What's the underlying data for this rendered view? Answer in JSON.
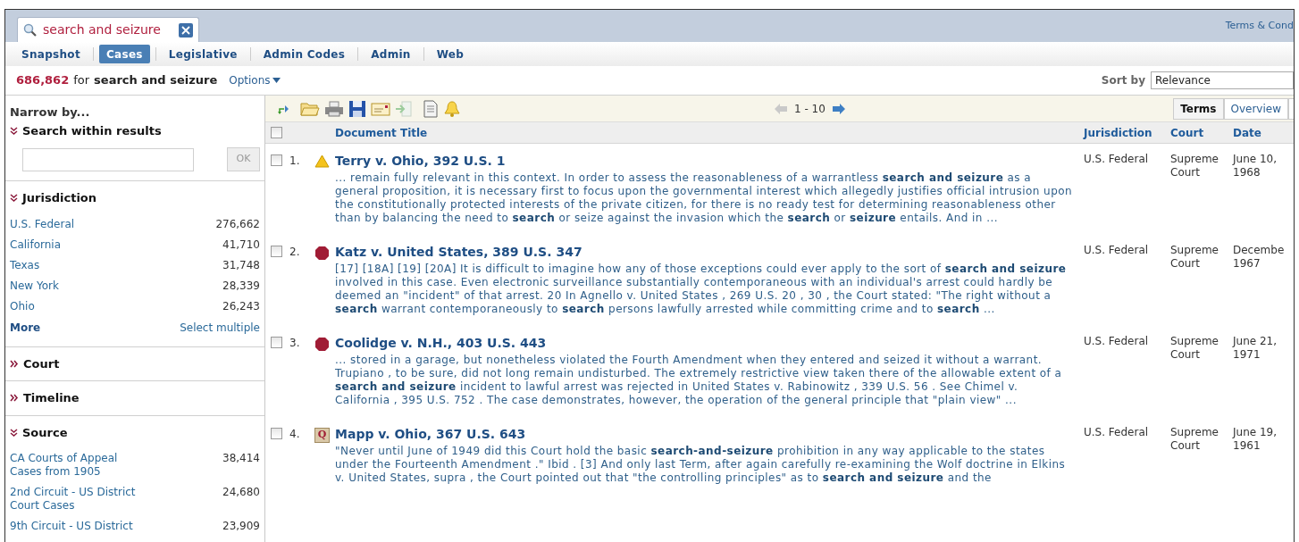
{
  "search_tab": {
    "query": "search and seizure"
  },
  "top_link": "Terms & Cond",
  "nav_tabs": [
    {
      "label": "Snapshot",
      "selected": false
    },
    {
      "label": "Cases",
      "selected": true
    },
    {
      "label": "Legislative",
      "selected": false
    },
    {
      "label": "Admin Codes",
      "selected": false
    },
    {
      "label": "Admin",
      "selected": false
    },
    {
      "label": "Web",
      "selected": false
    }
  ],
  "result_summary": {
    "count": "686,862",
    "connector": "for",
    "query": "search and seizure",
    "options": "Options"
  },
  "sort": {
    "label": "Sort by",
    "value": "Relevance"
  },
  "sidebar": {
    "title": "Narrow by...",
    "search_within": {
      "title": "Search within results",
      "expanded": true,
      "button": "OK"
    },
    "sections": [
      {
        "title": "Jurisdiction",
        "expanded": true,
        "items": [
          {
            "label": "U.S. Federal",
            "count": "276,662"
          },
          {
            "label": "California",
            "count": "41,710"
          },
          {
            "label": "Texas",
            "count": "31,748"
          },
          {
            "label": "New York",
            "count": "28,339"
          },
          {
            "label": "Ohio",
            "count": "26,243"
          }
        ],
        "more": "More",
        "select_multiple": "Select multiple"
      },
      {
        "title": "Court",
        "expanded": false
      },
      {
        "title": "Timeline",
        "expanded": false
      },
      {
        "title": "Source",
        "expanded": true,
        "items": [
          {
            "label": "CA Courts of Appeal Cases from 1905",
            "count": "38,414"
          },
          {
            "label": "2nd Circuit - US District Court Cases",
            "count": "24,680"
          },
          {
            "label": "9th Circuit - US District",
            "count": "23,909"
          }
        ]
      }
    ]
  },
  "pager": {
    "range": "1 - 10"
  },
  "view_tabs": [
    {
      "label": "Terms",
      "selected": true
    },
    {
      "label": "Overview",
      "selected": false
    }
  ],
  "table": {
    "select_all_checked": false,
    "columns": [
      "Document Title",
      "Jurisdiction",
      "Court",
      "Date"
    ],
    "rows": [
      {
        "checked": false,
        "number": "1.",
        "flag": {
          "kind": "caution"
        },
        "title": "Terry v. Ohio, 392 U.S. 1",
        "snippet": "... remain fully relevant in this context. In order to assess the reasonableness of a warrantless **search and seizure** as a general proposition, it is necessary first to focus upon the governmental interest which allegedly justifies official intrusion upon the constitutionally protected interests of the private citizen, for there is no ready test for determining reasonableness other than by balancing the need to **search** or seize against the invasion which the **search** or **seizure** entails. And in ...",
        "jurisdiction": "U.S. Federal",
        "court": "Supreme Court",
        "date": "June 10, 1968"
      },
      {
        "checked": false,
        "number": "2.",
        "flag": {
          "kind": "negative"
        },
        "title": "Katz v. United States, 389 U.S. 347",
        "snippet": "[17] [18A] [19] [20A] It is difficult to imagine how any of those exceptions could ever apply to the sort of **search and seizure** involved in this case. Even electronic surveillance substantially contemporaneous with an individual's arrest could hardly be deemed an \"incident\" of that arrest. 20 In Agnello v. United States , 269 U.S. 20 , 30 , the Court stated: \"The right without a **search** warrant contemporaneously to **search** persons lawfully arrested while committing crime and to **search** ...",
        "jurisdiction": "U.S. Federal",
        "court": "Supreme Court",
        "date": "Decembe 1967"
      },
      {
        "checked": false,
        "number": "3.",
        "flag": {
          "kind": "negative"
        },
        "title": "Coolidge v. N.H., 403 U.S. 443",
        "snippet": "... stored in a garage, but nonetheless violated the Fourth Amendment when they entered and seized it without a warrant. Trupiano , to be sure, did not long remain undisturbed. The extremely restrictive view taken there of the allowable extent of a **search and seizure** incident to lawful arrest was rejected in United States v. Rabinowitz , 339 U.S. 56 . See Chimel v. California , 395 U.S. 752 . The case demonstrates, however, the operation of the general principle that \"plain view\" ...",
        "jurisdiction": "U.S. Federal",
        "court": "Supreme Court",
        "date": "June 21, 1971"
      },
      {
        "checked": false,
        "number": "4.",
        "flag": {
          "kind": "quoted",
          "label": "Q"
        },
        "title": "Mapp v. Ohio, 367 U.S. 643",
        "snippet": "\"Never until June of 1949 did this Court hold the basic **search-and-seizure** prohibition in any way applicable to the states under the Fourteenth Amendment .\" Ibid . [3] And only last Term, after again carefully re-examining the Wolf doctrine in Elkins v. United States, supra , the Court pointed out that \"the controlling principles\" as to **search and seizure** and the",
        "jurisdiction": "U.S. Federal",
        "court": "Supreme Court",
        "date": "June 19, 1961"
      }
    ]
  }
}
